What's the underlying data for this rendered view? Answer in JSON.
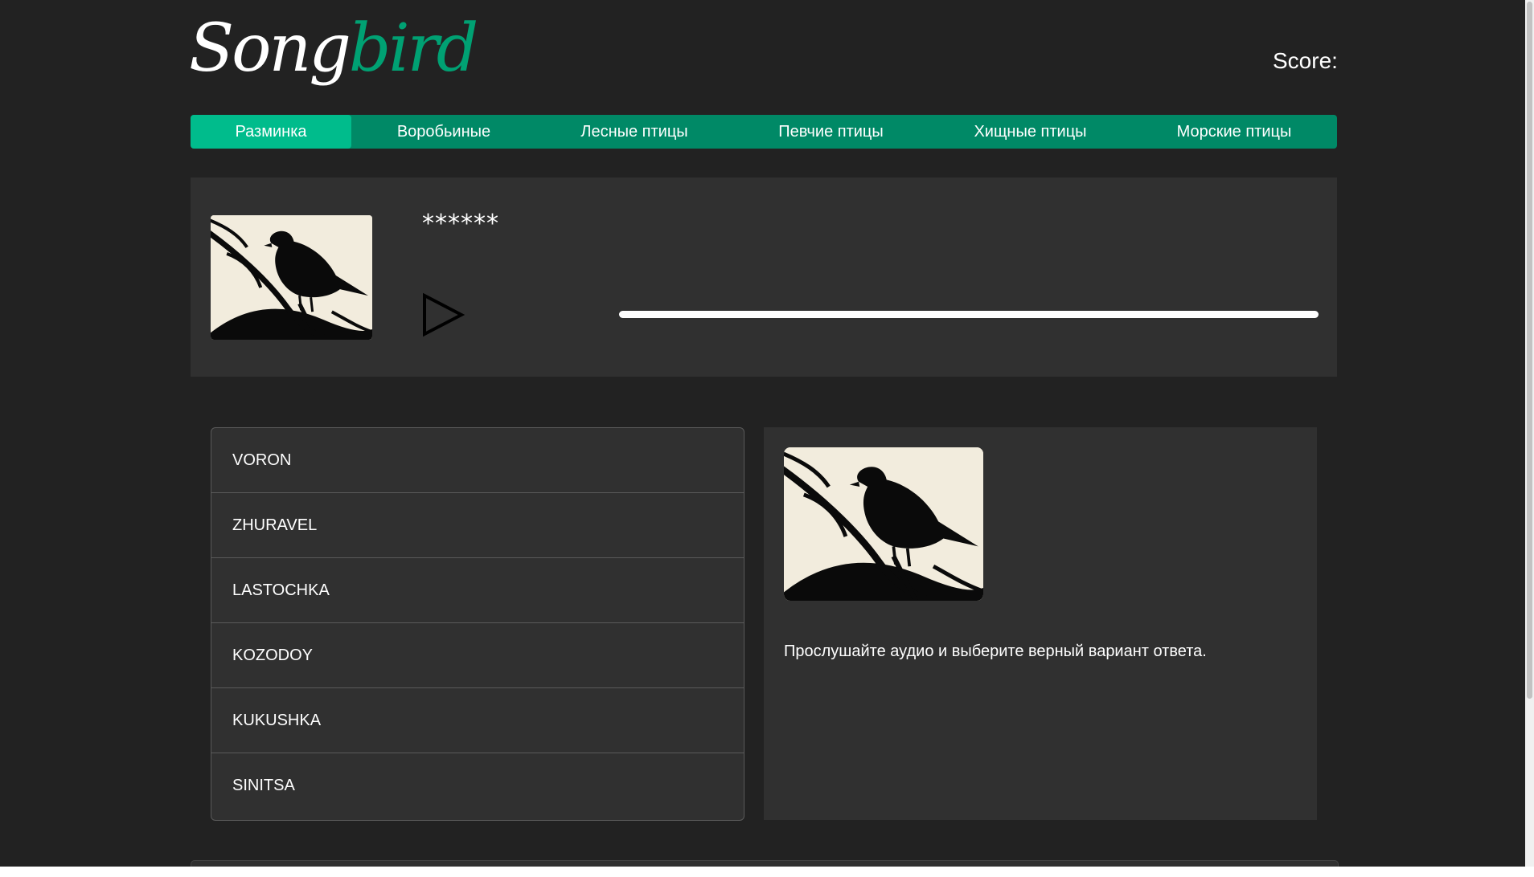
{
  "header": {
    "logo_part1": "Song",
    "logo_part2": "bird",
    "score_label": "Score:"
  },
  "nav": {
    "items": [
      {
        "label": "Разминка",
        "active": true
      },
      {
        "label": "Воробьиные",
        "active": false
      },
      {
        "label": "Лесные птицы",
        "active": false
      },
      {
        "label": "Певчие птицы",
        "active": false
      },
      {
        "label": "Хищные птицы",
        "active": false
      },
      {
        "label": "Морские птицы",
        "active": false
      }
    ]
  },
  "question": {
    "hidden_name": "******",
    "image_icon": "bird-silhouette",
    "play_icon": "play-icon",
    "progress": 1.0
  },
  "answers": [
    {
      "label": "VORON"
    },
    {
      "label": "ZHURAVEL"
    },
    {
      "label": "LASTOCHKA"
    },
    {
      "label": "KOZODOY"
    },
    {
      "label": "KUKUSHKA"
    },
    {
      "label": "SINITSA"
    }
  ],
  "details": {
    "image_icon": "bird-silhouette",
    "instruction": "Прослушайте аудио и выберите верный вариант ответа."
  },
  "colors": {
    "background": "#222222",
    "panel": "#303030",
    "nav": "#008966",
    "nav_active": "#00bc8c",
    "logo_accent": "#00a173"
  }
}
